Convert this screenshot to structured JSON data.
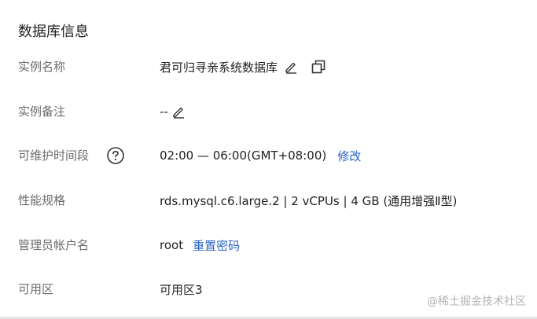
{
  "section": {
    "title": "数据库信息"
  },
  "rows": {
    "instance_name": {
      "label": "实例名称",
      "value": "君可归寻亲系统数据库"
    },
    "instance_note": {
      "label": "实例备注",
      "value": "--"
    },
    "maintenance": {
      "label": "可维护时间段",
      "value": "02:00 — 06:00(GMT+08:00)",
      "action": "修改"
    },
    "spec": {
      "label": "性能规格",
      "value": "rds.mysql.c6.large.2 | 2 vCPUs | 4 GB (通用增强Ⅱ型)"
    },
    "admin": {
      "label": "管理员帐户名",
      "value": "root",
      "action": "重置密码"
    },
    "zone": {
      "label": "可用区",
      "value": "可用区3"
    }
  },
  "watermark": "@稀土掘金技术社区",
  "icons": {
    "edit": "pencil-icon",
    "copy": "copy-icon",
    "help": "question-circle-icon"
  },
  "colors": {
    "link": "#2a63c7",
    "label": "#6b6b6b",
    "text": "#1f1f1f"
  }
}
